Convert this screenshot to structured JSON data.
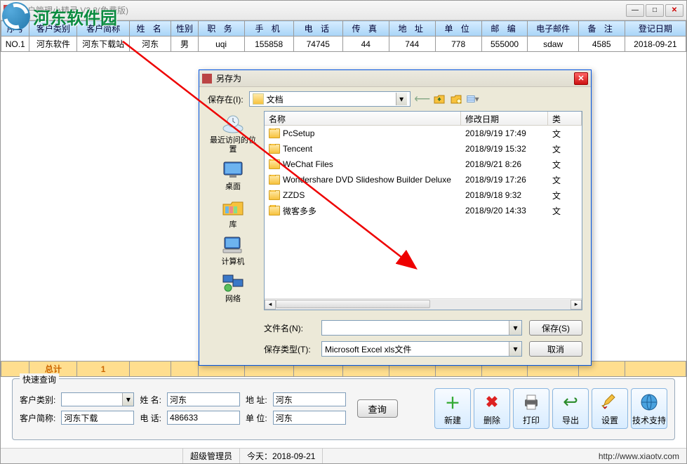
{
  "app": {
    "title": "客户管理小精灵 V3.3(免费版)"
  },
  "watermark": "河东软件园",
  "columns": [
    "序号",
    "客户类别",
    "客户简称",
    "姓 名",
    "性别",
    "职 务",
    "手 机",
    "电 话",
    "传 真",
    "地 址",
    "单 位",
    "邮 编",
    "电子邮件",
    "备 注",
    "登记日期"
  ],
  "row": {
    "no": "NO.1",
    "cat": "河东软件",
    "short": "河东下载站",
    "name": "河东",
    "sex": "男",
    "job": "uqi",
    "mobile": "155858",
    "tel": "74745",
    "fax": "44",
    "addr": "744",
    "unit": "778",
    "zip": "555000",
    "email": "sdaw",
    "note": "4585",
    "date": "2018-09-21"
  },
  "total": {
    "label": "总计",
    "count": "1"
  },
  "dialog": {
    "title": "另存为",
    "savein_label": "保存在(I):",
    "savein_value": "文档",
    "headers": {
      "name": "名称",
      "date": "修改日期",
      "type": "类"
    },
    "places": {
      "recent": "最近访问的位置",
      "desktop": "桌面",
      "library": "库",
      "computer": "计算机",
      "network": "网络"
    },
    "files": [
      {
        "name": "PcSetup",
        "date": "2018/9/19 17:49",
        "type": "文"
      },
      {
        "name": "Tencent",
        "date": "2018/9/19 15:32",
        "type": "文"
      },
      {
        "name": "WeChat Files",
        "date": "2018/9/21 8:26",
        "type": "文"
      },
      {
        "name": "Wondershare DVD Slideshow Builder Deluxe",
        "date": "2018/9/19 17:26",
        "type": "文"
      },
      {
        "name": "ZZDS",
        "date": "2018/9/18 9:32",
        "type": "文"
      },
      {
        "name": "微客多多",
        "date": "2018/9/20 14:33",
        "type": "文"
      }
    ],
    "filename_label": "文件名(N):",
    "filename_value": "",
    "filetype_label": "保存类型(T):",
    "filetype_value": "Microsoft Excel xls文件",
    "save_btn": "保存(S)",
    "cancel_btn": "取消"
  },
  "search": {
    "legend": "快速查询",
    "cat_label": "客户类别:",
    "cat_value": "",
    "name_label": "姓 名:",
    "name_value": "河东",
    "addr_label": "地 址:",
    "addr_value": "河东",
    "short_label": "客户简称:",
    "short_value": "河东下载",
    "tel_label": "电 话:",
    "tel_value": "486633",
    "unit_label": "单 位:",
    "unit_value": "河东",
    "query_btn": "查询"
  },
  "buttons": {
    "new": "新建",
    "del": "删除",
    "print": "打印",
    "export": "导出",
    "settings": "设置",
    "support": "技术支持"
  },
  "status": {
    "admin": "超级管理员",
    "today_label": "今天：",
    "today": "2018-09-21",
    "url": "http://www.xiaotv.com"
  }
}
